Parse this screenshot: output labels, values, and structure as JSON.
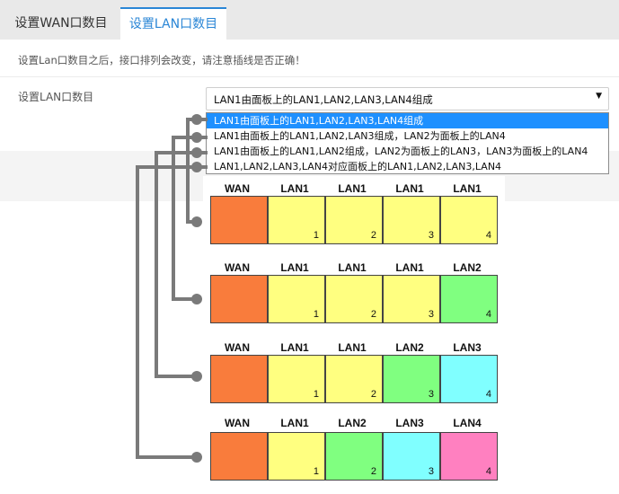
{
  "tabs": [
    {
      "label": "设置WAN口数目"
    },
    {
      "label": "设置LAN口数目"
    }
  ],
  "hint": "设置Lan口数目之后，接口排列会改变，请注意插线是否正确！",
  "field_label": "设置LAN口数目",
  "select": {
    "value": "LAN1由面板上的LAN1,LAN2,LAN3,LAN4组成",
    "arrow_icon": "triangle-down-icon",
    "options": [
      "LAN1由面板上的LAN1,LAN2,LAN3,LAN4组成",
      "LAN1由面板上的LAN1,LAN2,LAN3组成，LAN2为面板上的LAN4",
      "LAN1由面板上的LAN1,LAN2组成，LAN2为面板上的LAN3，LAN3为面板上的LAN4",
      "LAN1,LAN2,LAN3,LAN4对应面板上的LAN1,LAN2,LAN3,LAN4"
    ]
  },
  "colors": {
    "wan": "#f97c3c",
    "lan1": "#ffff80",
    "lan2": "#80ff80",
    "lan3": "#80ffff",
    "lan4": "#ff80c0",
    "accent": "#2a86d6"
  },
  "diagrams": [
    {
      "ports": [
        {
          "label": "WAN",
          "num": "",
          "color": "#f97c3c"
        },
        {
          "label": "LAN1",
          "num": "1",
          "color": "#ffff80"
        },
        {
          "label": "LAN1",
          "num": "2",
          "color": "#ffff80"
        },
        {
          "label": "LAN1",
          "num": "3",
          "color": "#ffff80"
        },
        {
          "label": "LAN1",
          "num": "4",
          "color": "#ffff80"
        }
      ]
    },
    {
      "ports": [
        {
          "label": "WAN",
          "num": "",
          "color": "#f97c3c"
        },
        {
          "label": "LAN1",
          "num": "1",
          "color": "#ffff80"
        },
        {
          "label": "LAN1",
          "num": "2",
          "color": "#ffff80"
        },
        {
          "label": "LAN1",
          "num": "3",
          "color": "#ffff80"
        },
        {
          "label": "LAN2",
          "num": "4",
          "color": "#80ff80"
        }
      ]
    },
    {
      "ports": [
        {
          "label": "WAN",
          "num": "",
          "color": "#f97c3c"
        },
        {
          "label": "LAN1",
          "num": "1",
          "color": "#ffff80"
        },
        {
          "label": "LAN1",
          "num": "2",
          "color": "#ffff80"
        },
        {
          "label": "LAN2",
          "num": "3",
          "color": "#80ff80"
        },
        {
          "label": "LAN3",
          "num": "4",
          "color": "#80ffff"
        }
      ]
    },
    {
      "ports": [
        {
          "label": "WAN",
          "num": "",
          "color": "#f97c3c"
        },
        {
          "label": "LAN1",
          "num": "1",
          "color": "#ffff80"
        },
        {
          "label": "LAN2",
          "num": "2",
          "color": "#80ff80"
        },
        {
          "label": "LAN3",
          "num": "3",
          "color": "#80ffff"
        },
        {
          "label": "LAN4",
          "num": "4",
          "color": "#ff80c0"
        }
      ]
    }
  ]
}
